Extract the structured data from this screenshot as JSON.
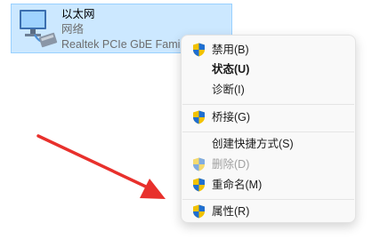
{
  "adapter": {
    "name": "以太网",
    "status": "网络",
    "device": "Realtek PCIe GbE Fami"
  },
  "menu": {
    "items": [
      {
        "label": "禁用(B)",
        "shield": true,
        "bold": false,
        "disabled": false
      },
      {
        "label": "状态(U)",
        "shield": false,
        "bold": true,
        "disabled": false
      },
      {
        "label": "诊断(I)",
        "shield": false,
        "bold": false,
        "disabled": false
      },
      {
        "label": "桥接(G)",
        "shield": true,
        "bold": false,
        "disabled": false
      },
      {
        "label": "创建快捷方式(S)",
        "shield": false,
        "bold": false,
        "disabled": false
      },
      {
        "label": "删除(D)",
        "shield": true,
        "bold": false,
        "disabled": true
      },
      {
        "label": "重命名(M)",
        "shield": true,
        "bold": false,
        "disabled": false
      },
      {
        "label": "属性(R)",
        "shield": true,
        "bold": false,
        "disabled": false
      }
    ]
  },
  "colors": {
    "selection": "#cce8ff",
    "arrow": "#e8302c",
    "shield_blue": "#1f6fd1",
    "shield_yellow": "#f2c200"
  }
}
